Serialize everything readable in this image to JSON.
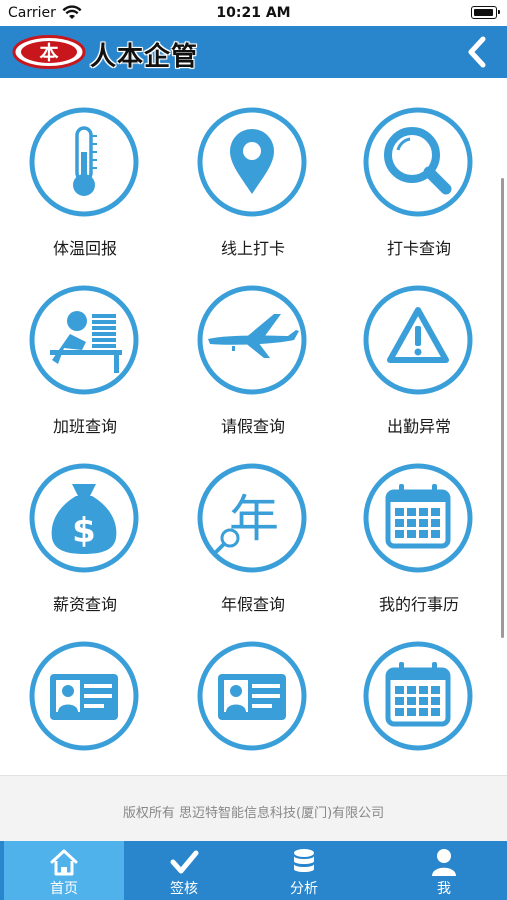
{
  "status_bar": {
    "carrier": "Carrier",
    "time": "10:21 AM"
  },
  "header": {
    "logo_char": "本",
    "title": "人本企管",
    "back_icon": "chevron-left-icon"
  },
  "grid": {
    "items": [
      {
        "label": "体温回报",
        "icon": "thermometer-icon"
      },
      {
        "label": "线上打卡",
        "icon": "location-pin-icon"
      },
      {
        "label": "打卡查询",
        "icon": "magnifier-icon"
      },
      {
        "label": "加班查询",
        "icon": "overtime-desk-icon"
      },
      {
        "label": "请假查询",
        "icon": "airplane-icon"
      },
      {
        "label": "出勤异常",
        "icon": "warning-icon"
      },
      {
        "label": "薪资查询",
        "icon": "money-bag-icon"
      },
      {
        "label": "年假查询",
        "icon": "annual-leave-icon",
        "glyph": "年"
      },
      {
        "label": "我的行事历",
        "icon": "calendar-icon"
      },
      {
        "label": "",
        "icon": "id-card-icon"
      },
      {
        "label": "",
        "icon": "id-card-icon"
      },
      {
        "label": "",
        "icon": "calendar-icon"
      }
    ]
  },
  "footer": {
    "copyright": "版权所有 思迈特智能信息科技(厦门)有限公司"
  },
  "tab_bar": {
    "tabs": [
      {
        "label": "首页",
        "icon": "home-icon",
        "active": true
      },
      {
        "label": "签核",
        "icon": "checkmark-icon",
        "active": false
      },
      {
        "label": "分析",
        "icon": "database-icon",
        "active": false
      },
      {
        "label": "我",
        "icon": "user-icon",
        "active": false
      }
    ]
  },
  "colors": {
    "primary": "#2a86cc",
    "icon_blue": "#3a9fd9",
    "tab_active": "#4fb2ea",
    "logo_red": "#c8161d"
  }
}
